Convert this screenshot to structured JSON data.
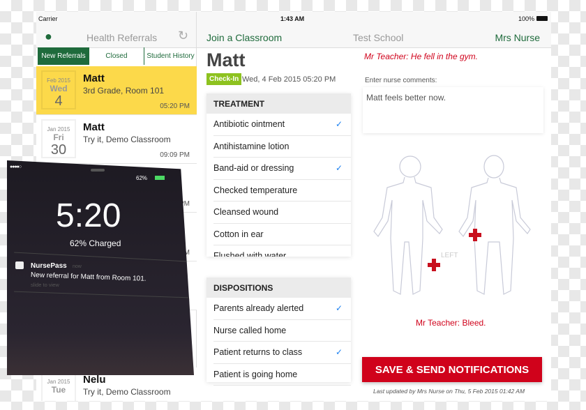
{
  "status": {
    "carrier": "Carrier",
    "time": "1:43 AM",
    "battery": "100%"
  },
  "sidebar": {
    "title": "Health Referrals",
    "tabs": [
      "New Referrals",
      "Closed",
      "Student History"
    ],
    "items": [
      {
        "month": "Feb 2015",
        "day": "Wed",
        "date": "4",
        "name": "Matt",
        "sub": "3rd Grade, Room 101",
        "time": "05:20 PM",
        "selected": true
      },
      {
        "month": "Jan 2015",
        "day": "Fri",
        "date": "30",
        "name": "Matt",
        "sub": "Try it, Demo Classroom",
        "time": "09:09 PM"
      },
      {
        "time": "…6 PM"
      },
      {
        "time": "AM"
      },
      {
        "time": "M"
      },
      {
        "month": "Jan 2015",
        "day": "Tue",
        "date": "",
        "name": "Nelu",
        "sub": "Try it, Demo Classroom"
      }
    ]
  },
  "nav": {
    "join": "Join a Classroom",
    "school": "Test School",
    "user": "Mrs Nurse"
  },
  "student": {
    "name": "Matt",
    "badge": "Check-In",
    "datetime": "Wed, 4 Feb 2015 05:20 PM"
  },
  "treatment": {
    "title": "TREATMENT",
    "items": [
      {
        "label": "Antibiotic ointment",
        "checked": true
      },
      {
        "label": "Antihistamine lotion",
        "checked": false
      },
      {
        "label": "Band-aid or dressing",
        "checked": true
      },
      {
        "label": "Checked temperature",
        "checked": false
      },
      {
        "label": "Cleansed wound",
        "checked": false
      },
      {
        "label": "Cotton in ear",
        "checked": false
      },
      {
        "label": "Flushed with water",
        "checked": false
      }
    ]
  },
  "dispositions": {
    "title": "DISPOSITIONS",
    "items": [
      {
        "label": "Parents already alerted",
        "checked": true
      },
      {
        "label": "Nurse called home",
        "checked": false
      },
      {
        "label": "Patient returns to class",
        "checked": true
      },
      {
        "label": "Patient is going home",
        "checked": false
      }
    ]
  },
  "teacher_note": "Mr Teacher: He fell in the gym.",
  "comments": {
    "label": "Enter nurse comments:",
    "value": "Matt feels better now."
  },
  "body_map": {
    "side_label": "LEFT",
    "note": "Mr Teacher: Bleed."
  },
  "save_button": "SAVE & SEND NOTIFICATIONS",
  "last_updated": "Last updated by Mrs Nurse on Thu, 5 Feb 2015 01:42 AM",
  "phone": {
    "battery": "62%",
    "clock": "5:20",
    "charge": "62% Charged",
    "app": "NursePass",
    "when": "now",
    "message": "New referral for Matt from Room 101.",
    "slide": "slide to view"
  },
  "colors": {
    "green": "#1f6b3c",
    "highlight": "#fcd94a",
    "badge": "#8dc21f",
    "red": "#d0021b",
    "check": "#1a7ff0"
  }
}
